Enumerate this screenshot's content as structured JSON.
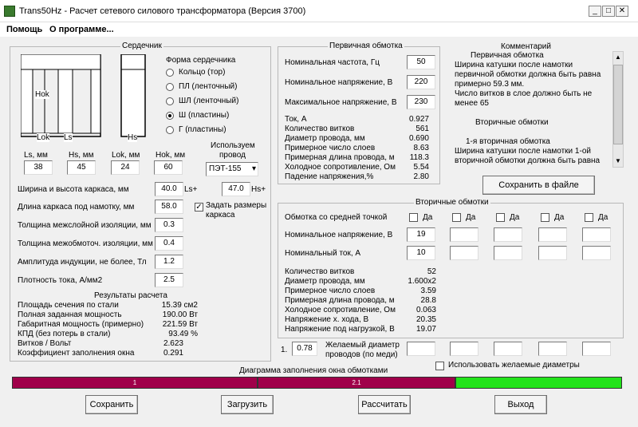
{
  "window": {
    "title": "Trans50Hz - Расчет сетевого силового трансформатора (Версия 3700)",
    "min": "_",
    "max": "□",
    "close": "✕"
  },
  "menu": {
    "help": "Помощь",
    "about": "О программе..."
  },
  "core": {
    "legend": "Сердечник",
    "shape_title": "Форма сердечника",
    "shapes": [
      "Кольцо  (тор)",
      "ПЛ  (ленточный)",
      "ШЛ  (ленточный)",
      "Ш  (пластины)",
      "Г (пластины)"
    ],
    "diagram": {
      "hok": "Hok",
      "lok": "Lok",
      "ls": "Ls",
      "hs": "Hs"
    },
    "dims": [
      {
        "label": "Ls, мм",
        "value": "38"
      },
      {
        "label": "Hs, мм",
        "value": "45"
      },
      {
        "label": "Lok, мм",
        "value": "24"
      },
      {
        "label": "Hok, мм",
        "value": "60"
      }
    ],
    "wire_label1": "Используем",
    "wire_label2": "провод",
    "wire_value": "ПЭТ-155",
    "frame_size_label": "Ширина и высота каркаса, мм",
    "frame_w": "40.0",
    "ls_plus": "Ls+",
    "frame_h": "47.0",
    "hs_plus": "Hs+",
    "frame_len_label": "Длина каркаса под намотку, мм",
    "frame_len": "58.0",
    "set_frame1": "Задать размеры",
    "set_frame2": "каркаса",
    "interlayer_label": "Толщина межслойной изоляции, мм",
    "interlayer": "0.3",
    "interwinding_label": "Толщина межобмоточ. изоляции, мм",
    "interwinding": "0.4",
    "induction_label": "Амплитуда индукции, не более, Тл",
    "induction": "1.2",
    "current_density_label": "Плотность тока, А/мм2",
    "current_density": "2.5",
    "results_title": "Результаты расчета",
    "results": [
      {
        "label": "Площадь сечения по стали",
        "value": "15.39 см2"
      },
      {
        "label": "Полная заданная мощность",
        "value": "190.00 Вт"
      },
      {
        "label": "Габаритная мощность (примерно)",
        "value": "221.59 Вт"
      },
      {
        "label": "КПД (без потерь в стали)",
        "value": "93.49 %"
      },
      {
        "label": "Витков / Вольт",
        "value": "2.623"
      },
      {
        "label": "Коэффициент заполнения окна",
        "value": "0.291"
      }
    ]
  },
  "primary": {
    "legend": "Первичная обмотка",
    "freq_label": "Номинальная частота, Гц",
    "freq": "50",
    "volt_label": "Номинальное напряжение, В",
    "volt": "220",
    "vmax_label": "Максимальное напряжение, В",
    "vmax": "230",
    "results": [
      {
        "label": "Ток, А",
        "value": "0.927"
      },
      {
        "label": "Количество витков",
        "value": "561"
      },
      {
        "label": "Диаметр провода, мм",
        "value": "0.690"
      },
      {
        "label": "Примерное число слоев",
        "value": "8.63"
      },
      {
        "label": "Примерная длина провода, м",
        "value": "118.3"
      },
      {
        "label": "Холодное сопротивление, Ом",
        "value": "5.54"
      },
      {
        "label": "Падение напряжения,%",
        "value": "2.80"
      }
    ]
  },
  "comment": {
    "title": "Комментарий",
    "lines": [
      "Первичная обмотка",
      "Ширина катушки после намотки",
      "первичной обмотки должна быть равна",
      "примерно 59.3 мм.",
      "Число витков в слое должно быть не",
      "менее 65",
      "",
      "Вторичные обмотки",
      "",
      "1-я вторичная обмотка",
      "Ширина катушки после намотки 1-ой",
      "вторичной обмотки должна быть равна"
    ],
    "save_button": "Сохранить в файле"
  },
  "secondary": {
    "legend": "Вторичные обмотки",
    "midpoint_label": "Обмотка со средней точкой",
    "yes": "Да",
    "volt_label": "Номинальное напряжение, В",
    "volt": "19",
    "current_label": "Номинальный ток, А",
    "current": "10",
    "results": [
      {
        "label": "Количество витков",
        "value": "52"
      },
      {
        "label": "Диаметр провода, мм",
        "value": "1.600x2"
      },
      {
        "label": "Примерное число слоев",
        "value": "3.59"
      },
      {
        "label": "Примерная длина провода, м",
        "value": "28.8"
      },
      {
        "label": "Холодное сопротивление, Ом",
        "value": "0.063"
      },
      {
        "label": "Напряжение х. хода, В",
        "value": "20.35"
      },
      {
        "label": "Напряжение под нагрузкой, В",
        "value": "19.07"
      }
    ],
    "desired_num": "1.",
    "desired_value": "0.78",
    "desired_label1": "Желаемый диаметр",
    "desired_label2": "проводов  (по меди)",
    "use_desired": "Использовать желаемые диаметры"
  },
  "fill": {
    "title": "Диаграмма заполнения окна обмотками",
    "segments": [
      {
        "label": "1",
        "fraction": 0.4025,
        "color": "#a0004a"
      },
      {
        "label": "2.1",
        "fraction": 0.3245,
        "color": "#a0004a"
      },
      {
        "label": "",
        "fraction": 0.273,
        "color": "#22e31a"
      }
    ]
  },
  "buttons": {
    "save": "Сохранить",
    "load": "Загрузить",
    "calc": "Рассчитать",
    "exit": "Выход"
  }
}
